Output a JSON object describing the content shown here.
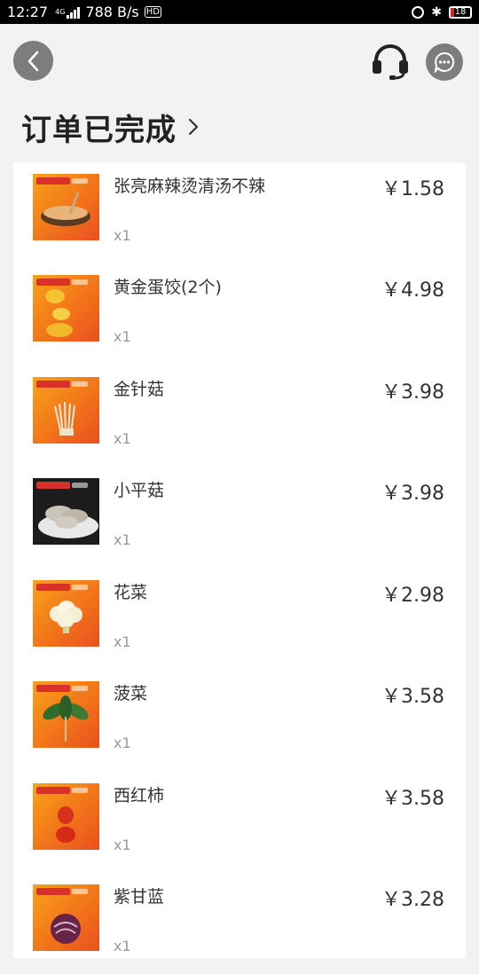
{
  "status_bar": {
    "time": "12:27",
    "network": "4G",
    "speed": "788 B/s",
    "hd": "HD",
    "battery": "18",
    "battery_level": 0.18,
    "battery_color": "#e02020"
  },
  "header": {
    "back_icon": "back-arrow-icon",
    "service_icon": "headset-icon",
    "message_icon": "chat-bubble-icon"
  },
  "page": {
    "title": "订单已完成",
    "title_icon": "chevron-right-icon"
  },
  "items": [
    {
      "name": "张亮麻辣烫清汤不辣",
      "qty": "x1",
      "price": "￥1.58",
      "image": "hotpot-bowl"
    },
    {
      "name": "黄金蛋饺(2个)",
      "qty": "x1",
      "price": "￥4.98",
      "image": "egg-dumplings"
    },
    {
      "name": "金针菇",
      "qty": "x1",
      "price": "￥3.98",
      "image": "enoki-mushroom"
    },
    {
      "name": "小平菇",
      "qty": "x1",
      "price": "￥3.98",
      "image": "oyster-mushroom"
    },
    {
      "name": "花菜",
      "qty": "x1",
      "price": "￥2.98",
      "image": "cauliflower"
    },
    {
      "name": "菠菜",
      "qty": "x1",
      "price": "￥3.58",
      "image": "spinach"
    },
    {
      "name": "西红柿",
      "qty": "x1",
      "price": "￥3.58",
      "image": "tomato"
    },
    {
      "name": "紫甘蓝",
      "qty": "x1",
      "price": "￥3.28",
      "image": "purple-cabbage"
    }
  ],
  "colors": {
    "background": "#f2f2f2",
    "button_gray": "#7d7d7d",
    "thumb_orange": "#f2741a"
  }
}
